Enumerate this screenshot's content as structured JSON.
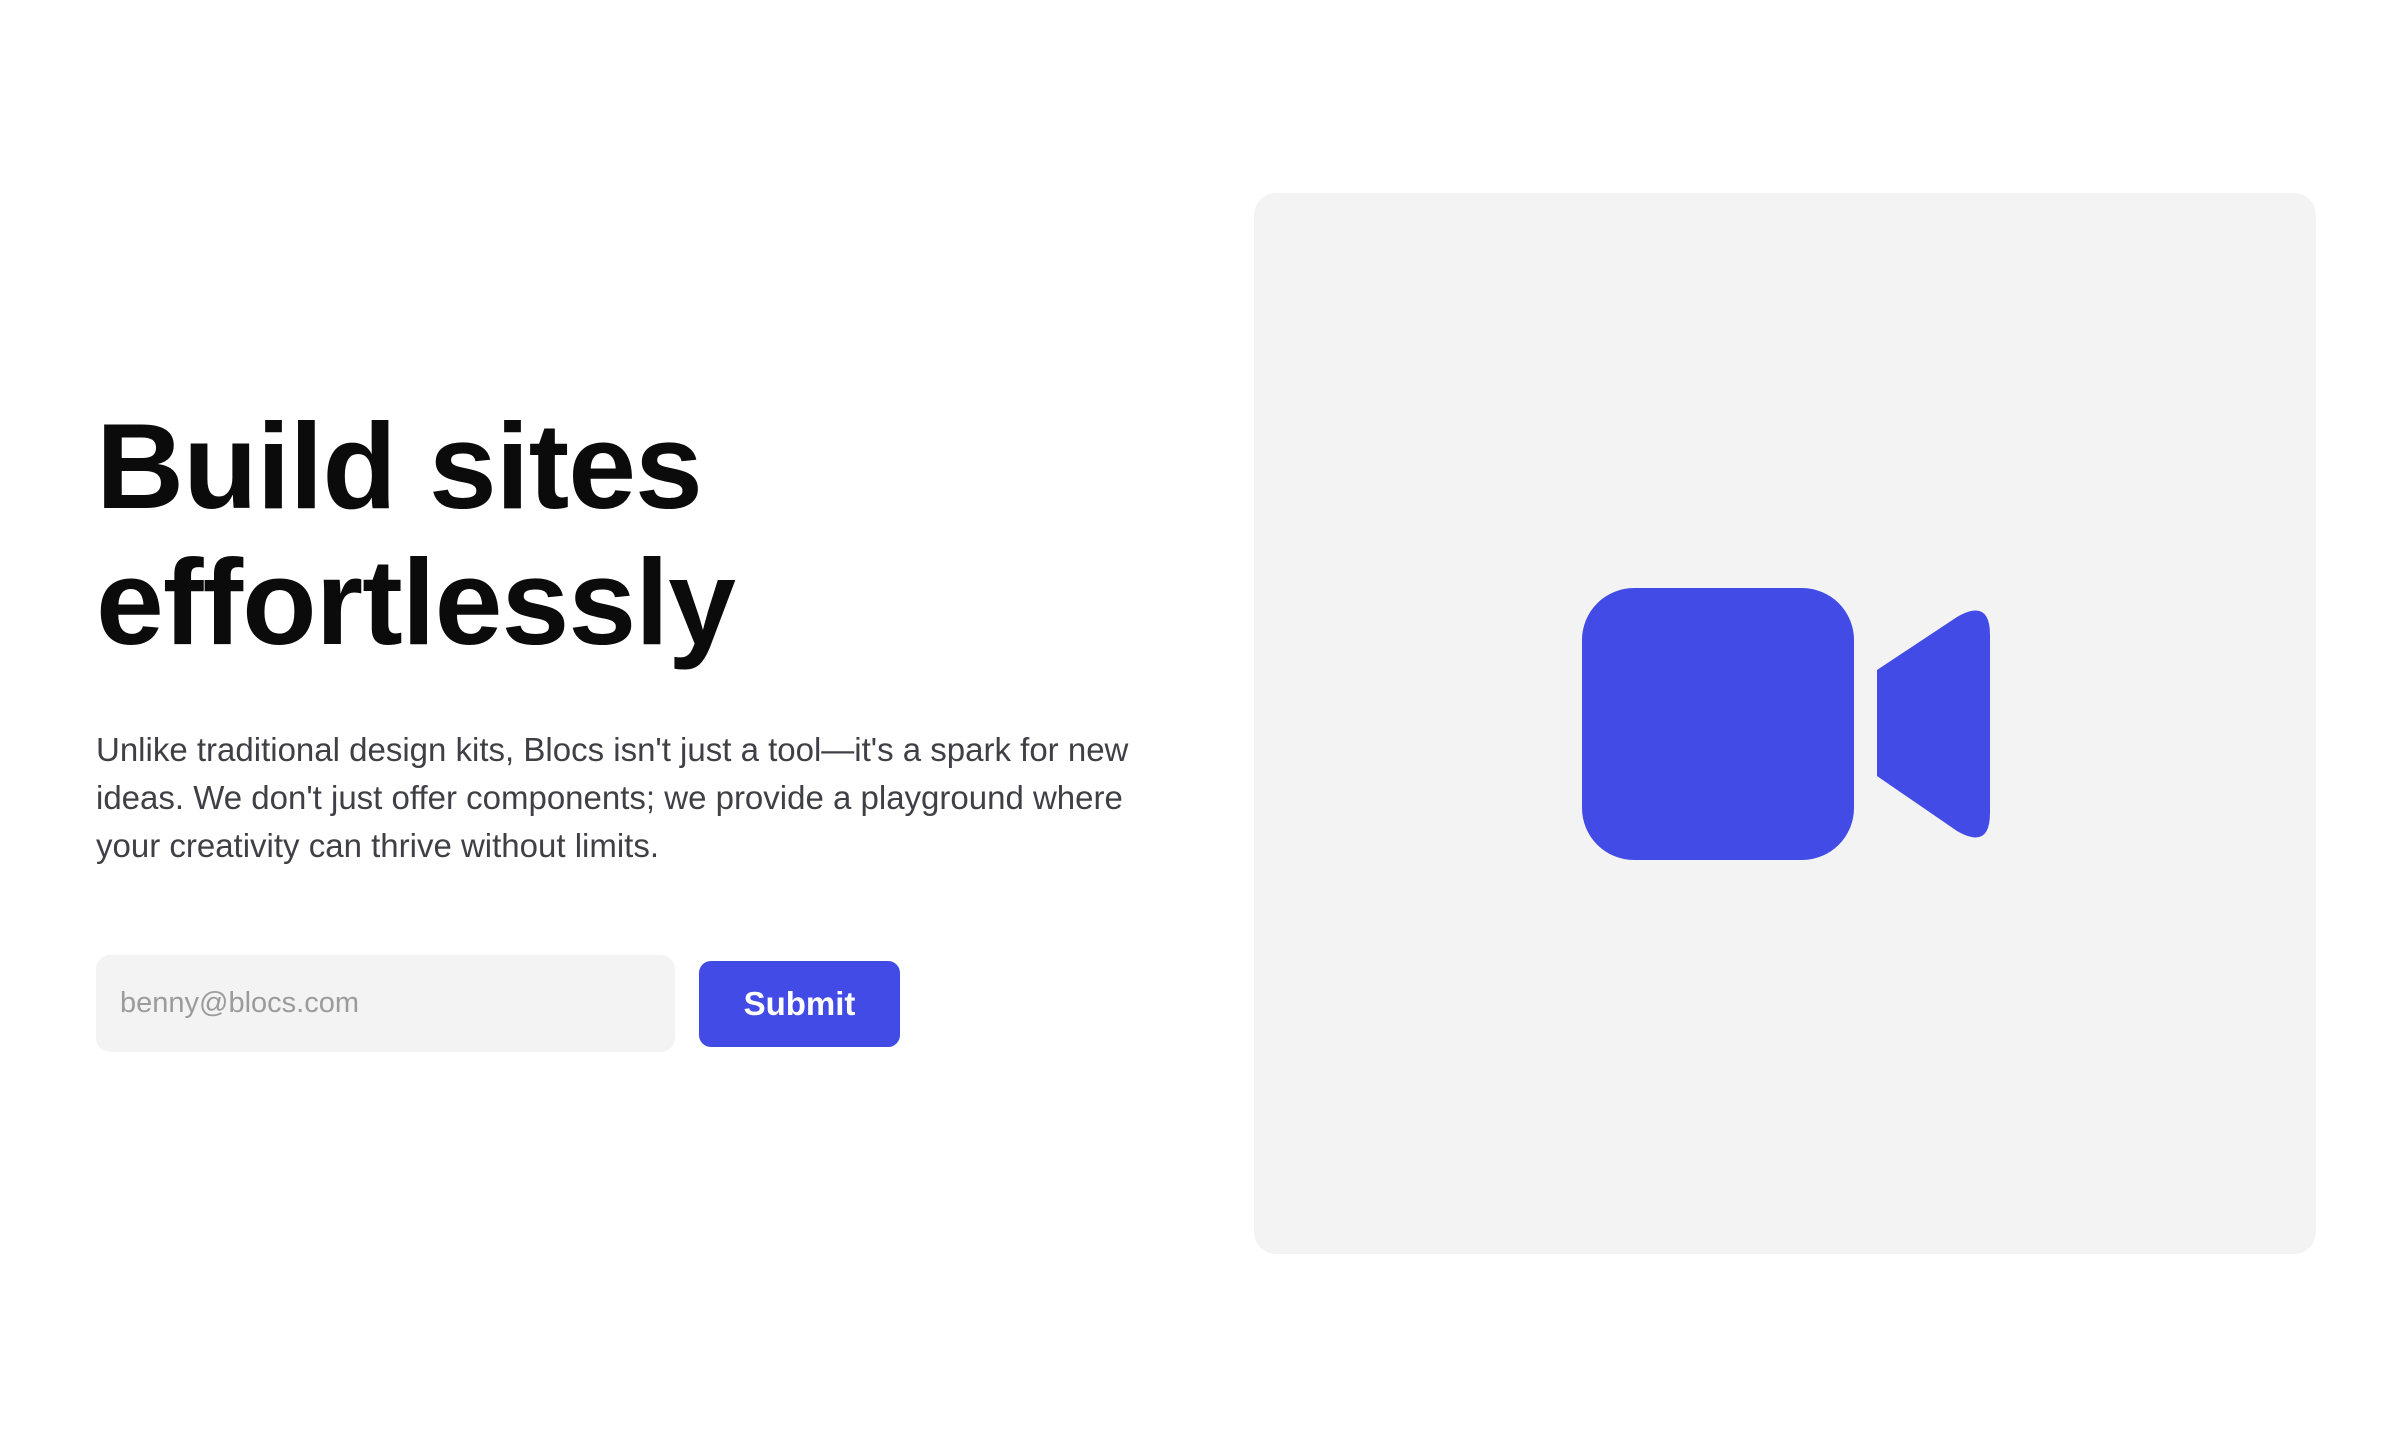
{
  "hero": {
    "headline_line1": "Build sites",
    "headline_line2": "effortlessly",
    "description": "Unlike traditional design kits, Blocs isn't just a tool—it's a spark for new ideas. We don't just offer components; we provide a playground where your creativity can thrive without limits."
  },
  "form": {
    "email_placeholder": "benny@blocs.com",
    "email_value": "",
    "submit_label": "Submit"
  },
  "media": {
    "icon": "video-camera-icon",
    "icon_color": "#424be5",
    "panel_color": "#f3f3f3"
  },
  "colors": {
    "accent": "#424be5",
    "text": "#0b0b0b",
    "muted_text": "#3f3f46"
  }
}
